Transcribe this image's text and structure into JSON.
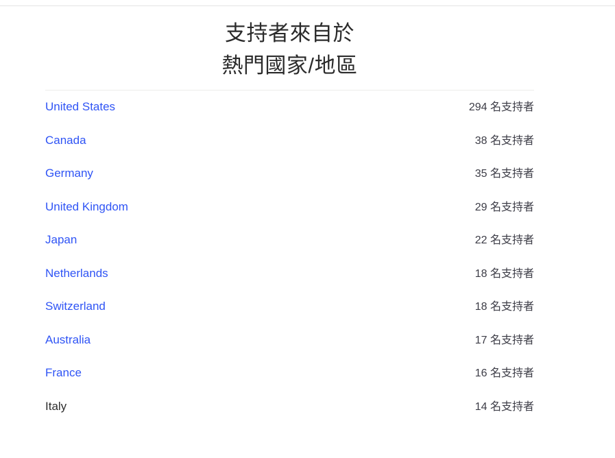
{
  "header": {
    "title_lines": [
      "支持者來自於",
      "熱門國家/地區"
    ],
    "title_full": "支持者來自於熱門國家/地區"
  },
  "colors": {
    "link_blue": "#2f54f5",
    "text_dark": "#2d2d2d",
    "count_text": "#3c3c46",
    "divider": "#ececea",
    "top_rule": "#e3e3e3",
    "background": "#ffffff"
  },
  "list": {
    "rows": [
      {
        "country": "United States",
        "count_text": "294 名支持者",
        "count": 294,
        "is_link": true
      },
      {
        "country": "Canada",
        "count_text": "38 名支持者",
        "count": 38,
        "is_link": true
      },
      {
        "country": "Germany",
        "count_text": "35 名支持者",
        "count": 35,
        "is_link": true
      },
      {
        "country": "United Kingdom",
        "count_text": "29 名支持者",
        "count": 29,
        "is_link": true
      },
      {
        "country": "Japan",
        "count_text": "22 名支持者",
        "count": 22,
        "is_link": true
      },
      {
        "country": "Netherlands",
        "count_text": "18 名支持者",
        "count": 18,
        "is_link": true
      },
      {
        "country": "Switzerland",
        "count_text": "18 名支持者",
        "count": 18,
        "is_link": true
      },
      {
        "country": "Australia",
        "count_text": "17 名支持者",
        "count": 17,
        "is_link": true
      },
      {
        "country": "France",
        "count_text": "16 名支持者",
        "count": 16,
        "is_link": true
      },
      {
        "country": "Italy",
        "count_text": "14 名支持者",
        "count": 14,
        "is_link": false
      }
    ]
  }
}
